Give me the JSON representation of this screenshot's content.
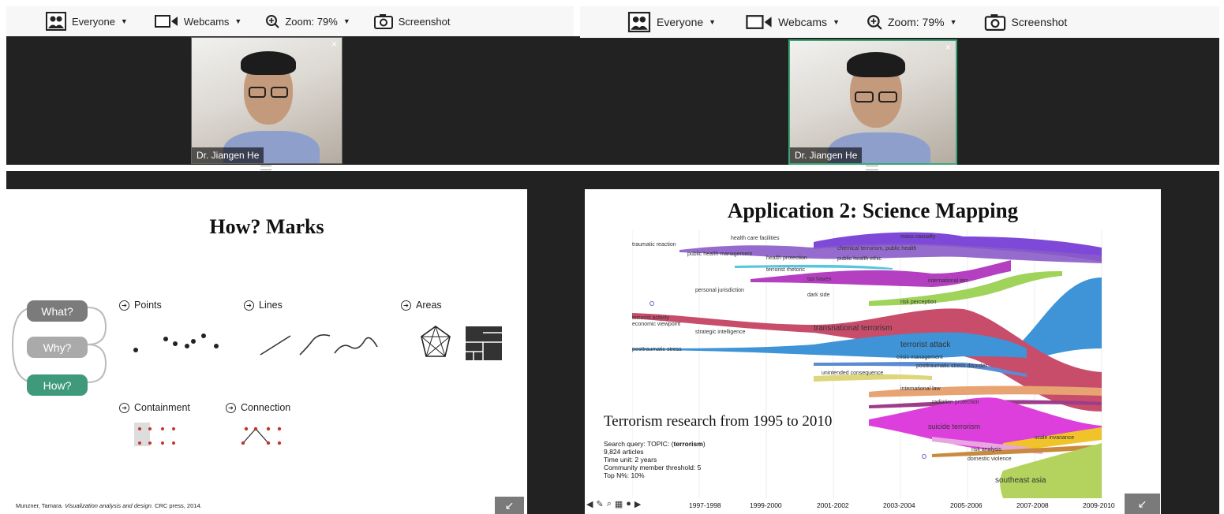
{
  "toolbar": {
    "everyone": "Everyone",
    "webcams": "Webcams",
    "zoom": "Zoom: 79%",
    "screenshot": "Screenshot"
  },
  "webcam": {
    "name": "Dr. Jiangen He",
    "close": "×"
  },
  "left_slide": {
    "title": "How? Marks",
    "pills": [
      "What?",
      "Why?",
      "How?"
    ],
    "categories": {
      "points": "Points",
      "lines": "Lines",
      "areas": "Areas",
      "containment": "Containment",
      "connection": "Connection"
    },
    "citation_author": "Munzner, Tamara. ",
    "citation_title": "Visualization analysis and design",
    "citation_rest": ". CRC press, 2014."
  },
  "right_slide": {
    "title": "Application 2: Science Mapping",
    "subtitle": "Terrorism research from 1995 to 2010",
    "info": {
      "query_prefix": "Search query: TOPIC: (",
      "query_term": "terrorism",
      "query_suffix": ")",
      "articles": "9,824 articles",
      "time_unit": "Time unit: 2 years",
      "threshold": "Community member threshold: 5",
      "top_n": "Top N%: 10%"
    },
    "time_ticks": [
      "1997-1998",
      "1999-2000",
      "2001-2002",
      "2003-2004",
      "2005-2006",
      "2007-2008",
      "2009-2010"
    ],
    "streams": [
      {
        "label": "traumatic reaction",
        "color": "#b46ab4"
      },
      {
        "label": "health care facilities",
        "color": "#8a5cc8"
      },
      {
        "label": "public health management",
        "color": "#8a5cc8"
      },
      {
        "label": "health protection",
        "color": "#8a5cc8"
      },
      {
        "label": "mass casualty",
        "color": "#7e48d8"
      },
      {
        "label": "chemical terrorism, public health",
        "color": "#7e48d8"
      },
      {
        "label": "public health ethic",
        "color": "#7e48d8"
      },
      {
        "label": "terrorist rhetoric",
        "color": "#55c6dd"
      },
      {
        "label": "tax haven",
        "color": "#a64bb8"
      },
      {
        "label": "personal jurisdiction",
        "color": "#a64bb8"
      },
      {
        "label": "international terr",
        "color": "#b43fc0"
      },
      {
        "label": "dark side",
        "color": "#8a6ab8"
      },
      {
        "label": "risk perception",
        "color": "#9fd35a"
      },
      {
        "label": "terrorist activity",
        "color": "#c74d6b"
      },
      {
        "label": "economic viewpoint",
        "color": "#c74d6b"
      },
      {
        "label": "transnational terrorism",
        "color": "#c74d6b"
      },
      {
        "label": "strategic intelligence",
        "color": "#c74d6b"
      },
      {
        "label": "posttraumatic stress",
        "color": "#3e94d6"
      },
      {
        "label": "terrorist attack",
        "color": "#3e94d6"
      },
      {
        "label": "crisis management",
        "color": "#3e94d6"
      },
      {
        "label": "posttraumatic stress disorder",
        "color": "#5a8bd3"
      },
      {
        "label": "unintended consequence",
        "color": "#ddd67a"
      },
      {
        "label": "international law",
        "color": "#e8a373"
      },
      {
        "label": "radiation protection",
        "color": "#9d3c8b"
      },
      {
        "label": "suicide terrorism",
        "color": "#dd3fdc"
      },
      {
        "label": "scale invariance",
        "color": "#f0c32a"
      },
      {
        "label": "risk analysis",
        "color": "#e7a6e0"
      },
      {
        "label": "domestic violence",
        "color": "#c98a3e"
      },
      {
        "label": "southeast asia",
        "color": "#b3d35e"
      }
    ]
  }
}
